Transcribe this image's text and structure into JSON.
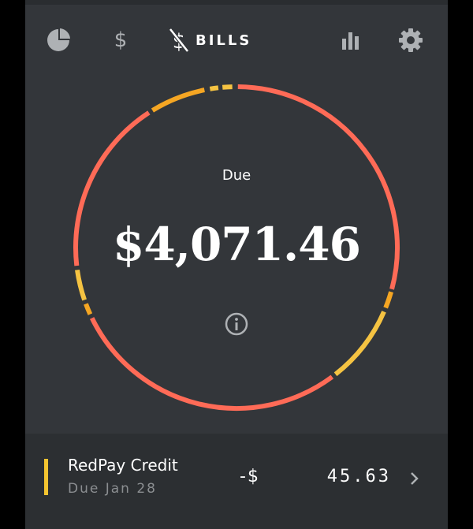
{
  "nav": {
    "items": [
      {
        "name": "overview",
        "icon": "pie-chart-icon"
      },
      {
        "name": "income",
        "icon": "dollar-icon",
        "glyph": "$"
      },
      {
        "name": "bills",
        "icon": "dollar-crossed-icon",
        "label": "BILLS",
        "active": true
      },
      {
        "name": "stats",
        "icon": "bar-chart-icon"
      },
      {
        "name": "settings",
        "icon": "gear-icon"
      }
    ]
  },
  "summary": {
    "label": "Due",
    "amount": "$4,071.46",
    "info_icon": "info-icon"
  },
  "ring": {
    "segments": [
      {
        "color": "#f5c342"
      },
      {
        "color": "#f5a623"
      },
      {
        "color": "#ff6b57"
      }
    ]
  },
  "bill": {
    "name": "RedPay Credit",
    "due": "Due Jan 28",
    "sign": "-$",
    "amount": "45.63",
    "stripe_color": "#f4c430",
    "chevron_icon": "chevron-right-icon"
  },
  "colors": {
    "background": "#33363a",
    "text": "#ffffff",
    "muted": "#8b8e91",
    "icon": "#aeb1b4"
  }
}
